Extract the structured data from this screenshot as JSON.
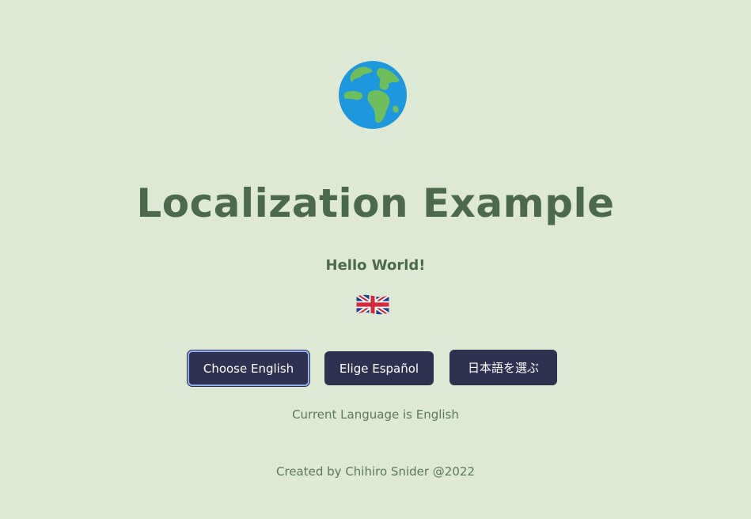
{
  "icons": {
    "globe": "globe-europe-africa-icon",
    "flag": "uk-flag-icon"
  },
  "title": "Localization Example",
  "greeting": "Hello World!",
  "buttons": {
    "english": "Choose English",
    "spanish": "Elige Español",
    "japanese": "日本語を選ぶ"
  },
  "status": {
    "current_language": "Current Language is English"
  },
  "footer": {
    "credit": "Created by Chihiro Snider @2022"
  },
  "colors": {
    "background": "#dde9d3",
    "heading": "#4b6a4b",
    "button": "#2e3150",
    "focus_ring": "#8fb2ef"
  }
}
